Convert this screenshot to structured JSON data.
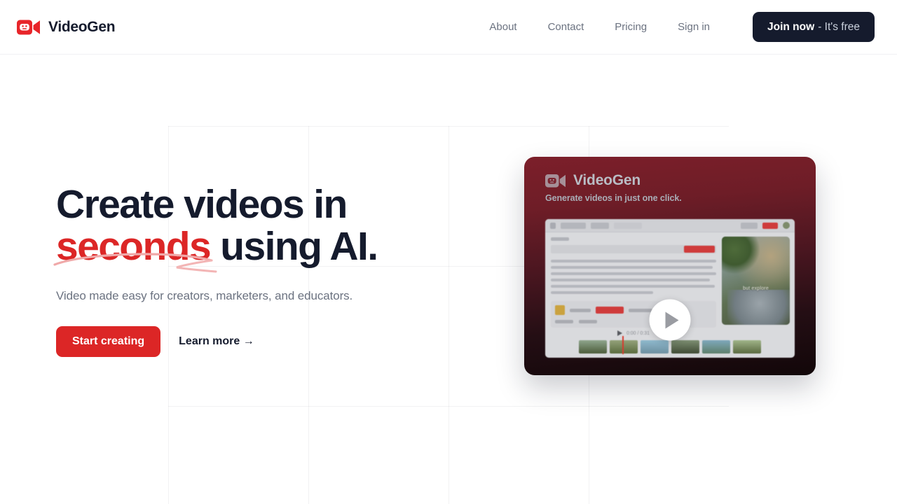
{
  "brand": {
    "name": "VideoGen",
    "icon": "video-camera-robot-icon"
  },
  "header": {
    "nav": [
      {
        "label": "About"
      },
      {
        "label": "Contact"
      },
      {
        "label": "Pricing"
      },
      {
        "label": "Sign in"
      }
    ],
    "cta": {
      "strong": "Join now",
      "light": "- It's free",
      "bg_color": "#151b2d"
    }
  },
  "hero": {
    "headline_line1": "Create videos in",
    "headline_accent": "seconds",
    "headline_rest": " using AI.",
    "accent_color": "#dc2626",
    "subhead": "Video made easy for creators, marketers, and educators.",
    "primary_cta": "Start creating",
    "secondary_cta": "Learn more →"
  },
  "video_card": {
    "brand_name": "VideoGen",
    "tagline": "Generate videos in just one click.",
    "play_button": "play-button",
    "gradient_top": "#7c1f2a",
    "gradient_bottom": "#120709",
    "preview": {
      "video_caption": "but explore",
      "player_time": "0:00 / 0:31"
    }
  }
}
